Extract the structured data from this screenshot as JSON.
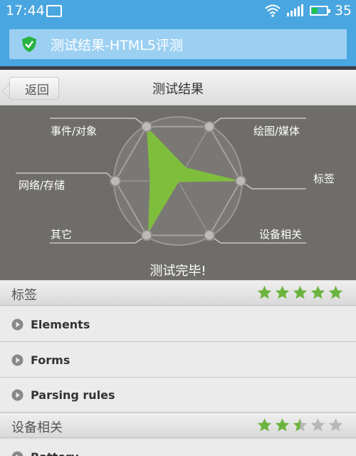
{
  "status_bar": {
    "time": "17:44",
    "battery_level": "35",
    "icons": [
      "image-icon",
      "wifi-icon",
      "signal-icon",
      "battery-icon"
    ]
  },
  "app_title": {
    "text": "测试结果-HTML5评测",
    "icon": "shield-check-icon",
    "colors": {
      "bar": "#4aa6e0",
      "box": "#9cd0f2",
      "shield": "#26b33f"
    }
  },
  "header": {
    "back_label": "返回",
    "title": "测试结果"
  },
  "radar": {
    "axes": [
      "标签",
      "设备相关",
      "其它",
      "网络/存储",
      "事件/对象",
      "绘图/媒体"
    ],
    "scores": [
      1.0,
      0.0,
      0.95,
      0.45,
      1.0,
      0.25
    ],
    "status_text": "测试完毕!",
    "colors": {
      "fill": "#7fc23a",
      "background": "#6f6d6a"
    }
  },
  "sections": [
    {
      "title": "标签",
      "rating": 5,
      "max": 5,
      "items": [
        "Elements",
        "Forms",
        "Parsing rules"
      ]
    },
    {
      "title": "设备相关",
      "rating": 2.5,
      "max": 5,
      "items": [
        "Battery"
      ]
    }
  ],
  "colors": {
    "star_on": "#6cb33e",
    "star_off": "#b8b8b8"
  }
}
